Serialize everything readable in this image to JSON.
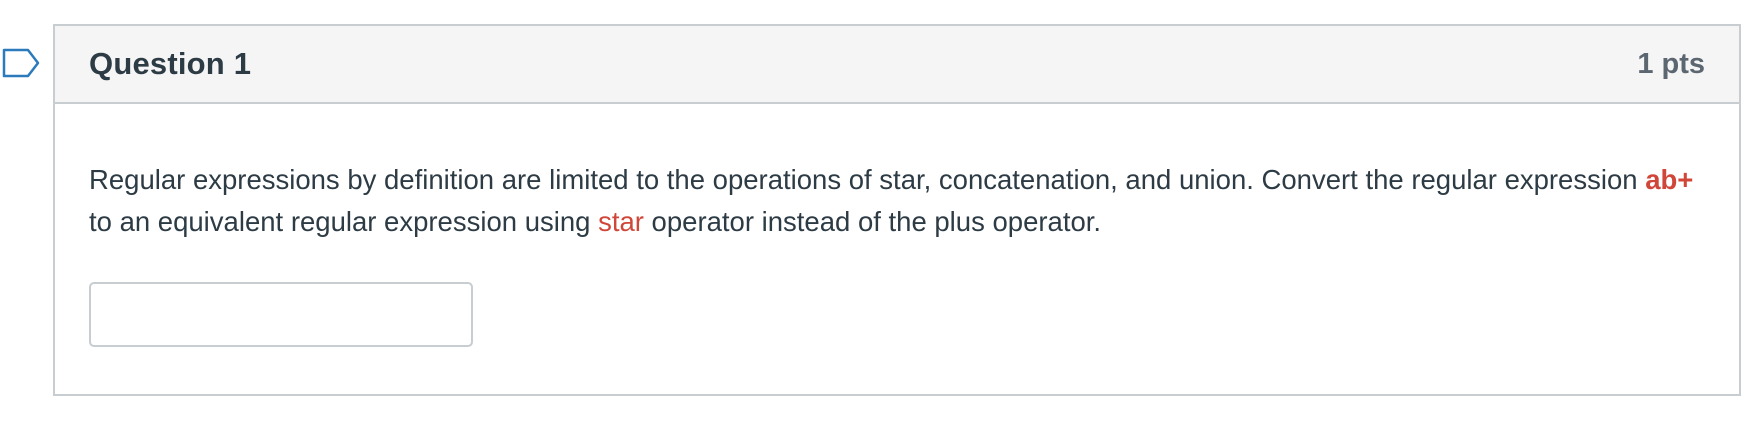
{
  "question": {
    "title": "Question 1",
    "points": "1 pts",
    "text": {
      "part1": "Regular expressions by definition are limited to the operations of star, concatenation, and union. Convert the regular expression ",
      "expression": "ab+",
      "part2": " to an equivalent regular expression using ",
      "operator": "star",
      "part3": " operator instead of the plus operator."
    },
    "answer": {
      "value": "",
      "placeholder": ""
    }
  },
  "colors": {
    "highlight": "#d0473a",
    "text": "#2d3b45",
    "header_bg": "#f5f5f5",
    "border": "#c7cdd1"
  },
  "icons": {
    "flag": "flag-outline-icon"
  }
}
